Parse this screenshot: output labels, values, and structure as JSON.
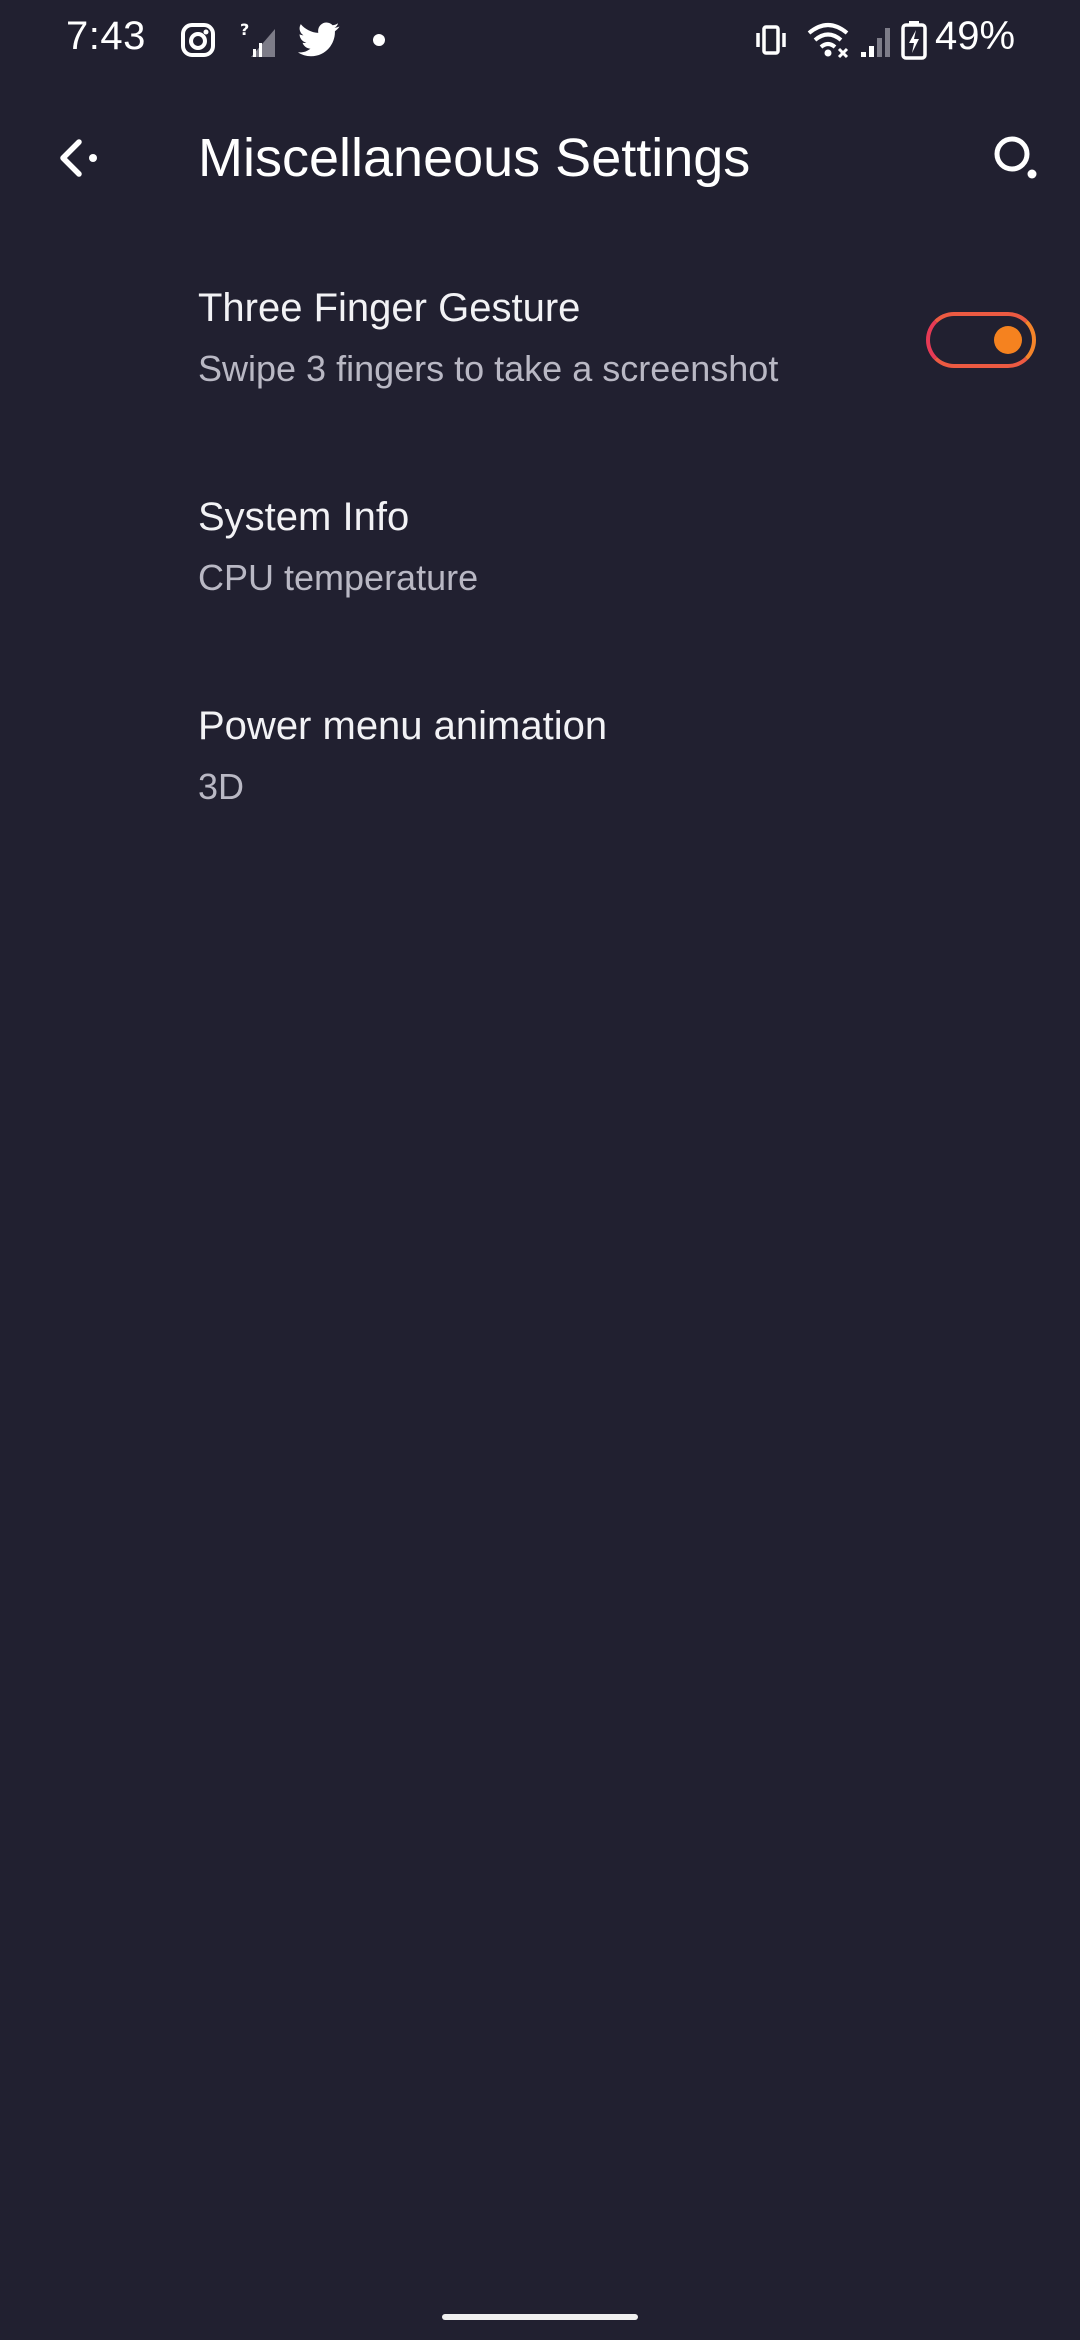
{
  "status_bar": {
    "time": "7:43",
    "battery": "49%",
    "icons": [
      "instagram-icon",
      "signal-unknown-icon",
      "twitter-icon",
      "notification-dot-icon",
      "vibrate-icon",
      "wifi-icon",
      "cell-signal-icon",
      "battery-charging-icon"
    ]
  },
  "app_bar": {
    "title": "Miscellaneous Settings",
    "back_icon": "back-arrow-icon",
    "search_icon": "search-icon"
  },
  "settings": [
    {
      "title": "Three Finger Gesture",
      "summary": "Swipe 3 fingers to take a screenshot",
      "toggle_on": true
    },
    {
      "title": "System Info",
      "summary": "CPU temperature"
    },
    {
      "title": "Power menu animation",
      "summary": "3D"
    }
  ],
  "colors": {
    "background": "#212030",
    "accent_start": "#e63a55",
    "accent_end": "#f5821f",
    "summary_text": "#b9b8c4"
  }
}
